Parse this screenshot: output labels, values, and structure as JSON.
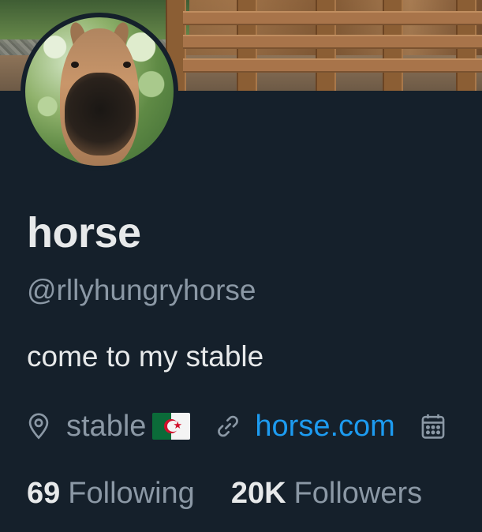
{
  "profile": {
    "display_name": "horse",
    "handle": "@rllyhungryhorse",
    "bio": "come to my stable",
    "location": "stable",
    "location_flag": "algeria-flag",
    "website": "horse.com",
    "following_count": "69",
    "following_label": "Following",
    "followers_count": "20K",
    "followers_label": "Followers"
  },
  "icons": {
    "location": "location-pin-icon",
    "link": "link-icon",
    "calendar": "calendar-icon"
  },
  "colors": {
    "background": "#15202b",
    "primary_text": "#e7e9ea",
    "secondary_text": "#8b98a5",
    "link": "#1d9bf0"
  }
}
